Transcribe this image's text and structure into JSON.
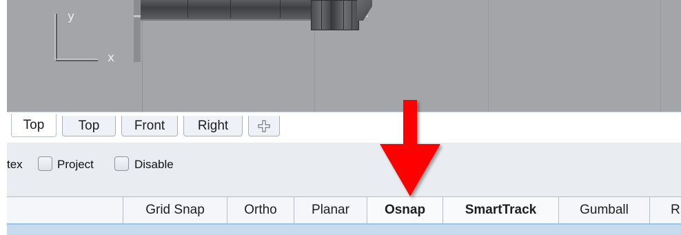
{
  "viewport": {
    "axis_y_label": "y",
    "axis_x_label": "x"
  },
  "tabs": [
    {
      "label": "Top",
      "active": true
    },
    {
      "label": "Top",
      "active": false
    },
    {
      "label": "Front",
      "active": false
    },
    {
      "label": "Right",
      "active": false
    }
  ],
  "add_tab_icon": "plus-outline-icon",
  "osnap_options": {
    "partial_label": "tex",
    "project_label": "Project",
    "project_checked": false,
    "disable_label": "Disable",
    "disable_checked": false
  },
  "status_bar": {
    "panes": [
      {
        "label": "Grid Snap",
        "active": false
      },
      {
        "label": "Ortho",
        "active": false
      },
      {
        "label": "Planar",
        "active": false
      },
      {
        "label": "Osnap",
        "active": true
      },
      {
        "label": "SmartTrack",
        "active": true
      },
      {
        "label": "Gumball",
        "active": false
      },
      {
        "label": "R",
        "active": false
      }
    ]
  },
  "annotation": {
    "arrow_icon": "red-down-arrow-icon",
    "arrow_color": "#ff0000"
  },
  "colors": {
    "viewport_bg": "#a4a5a9",
    "panel_bg": "#e9ecf1",
    "status_bottom": "#c7dbee"
  }
}
